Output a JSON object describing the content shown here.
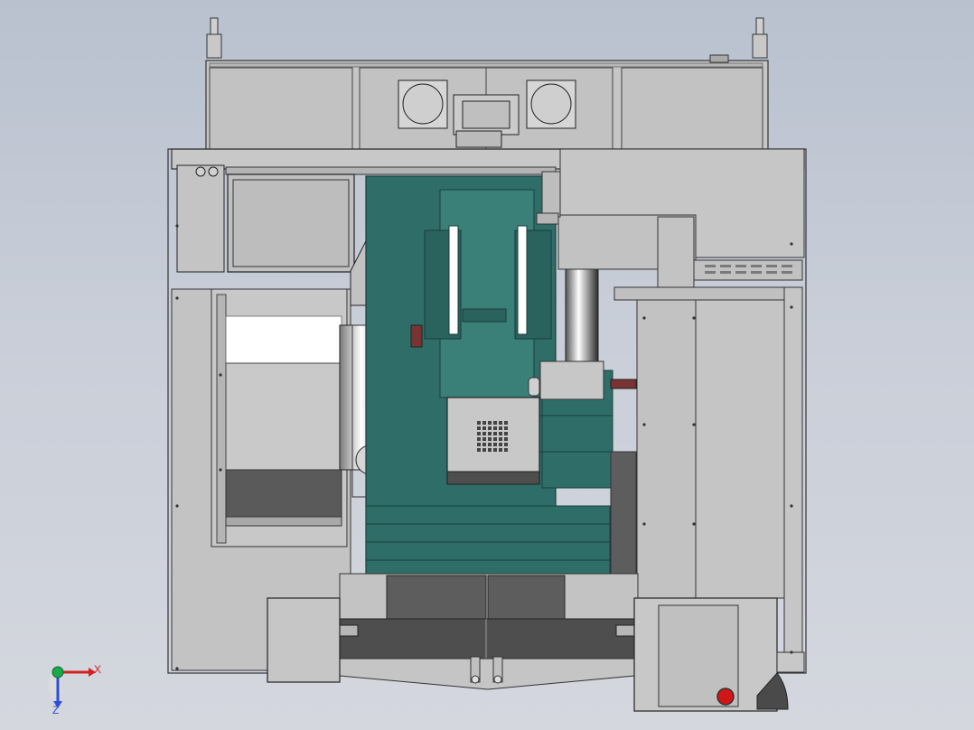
{
  "view": {
    "background_top": "#b9c1cf",
    "background_bottom": "#d4d7de"
  },
  "colors": {
    "frame": "#c4c4c4",
    "frame_dark": "#9a9a9a",
    "panel": "#bdbdbd",
    "teal": "#2f6e68",
    "teal_light": "#3a7f78",
    "dark": "#5d5d5d",
    "grill": "#8b8b8b",
    "estop": "#d01616",
    "axis_x": "#d42020",
    "axis_y": "#1aa84a",
    "axis_z": "#2a4fd6"
  },
  "triad": {
    "x_label": "X",
    "z_label": "Z"
  }
}
